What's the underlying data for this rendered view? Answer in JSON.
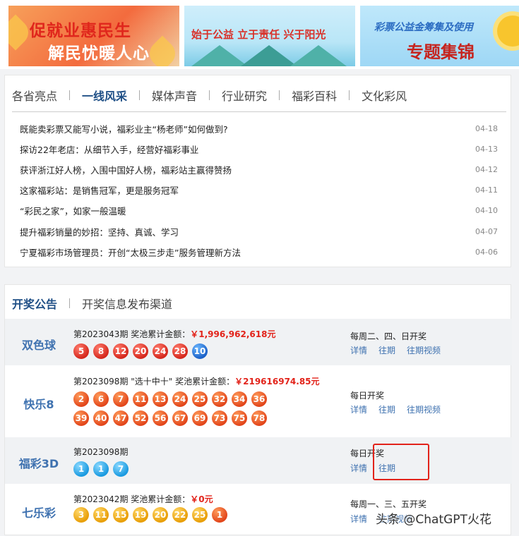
{
  "banners": [
    {
      "line1": "促就业惠民生",
      "line2": "解民忧暖人心"
    },
    {
      "line1": "始于公益 立于责任 兴于阳光"
    },
    {
      "line1": "彩票公益金筹集及使用",
      "line2": "专题集锦"
    }
  ],
  "news": {
    "tabs": [
      "各省亮点",
      "一线风采",
      "媒体声音",
      "行业研究",
      "福彩百科",
      "文化彩风"
    ],
    "active_tab": "一线风采",
    "items": [
      {
        "title": "既能卖彩票又能写小说，福彩业主“杨老师”如何做到?",
        "date": "04-18"
      },
      {
        "title": "探访22年老店：从细节入手，经营好福彩事业",
        "date": "04-13"
      },
      {
        "title": "获评浙江好人榜，入围中国好人榜，福彩站主赢得赞扬",
        "date": "04-12"
      },
      {
        "title": "这家福彩站：是销售冠军，更是服务冠军",
        "date": "04-11"
      },
      {
        "title": "“彩民之家”，如家一般温暖",
        "date": "04-10"
      },
      {
        "title": "提升福彩销量的妙招：坚持、真诚、学习",
        "date": "04-07"
      },
      {
        "title": "宁夏福彩市场管理员：开创“太极三步走”服务管理新方法",
        "date": "04-06"
      }
    ]
  },
  "draw": {
    "tabs": [
      "开奖公告",
      "开奖信息发布渠道"
    ],
    "games": [
      {
        "name": "双色球",
        "issue_text": "第2023043期  奖池累计金额：",
        "amount": "￥1,996,962,618元",
        "red": [
          "5",
          "8",
          "12",
          "20",
          "24",
          "28"
        ],
        "blue": [
          "10"
        ],
        "schedule": "每周二、四、日开奖",
        "links": [
          "详情",
          "往期",
          "往期视频"
        ]
      },
      {
        "name": "快乐8",
        "issue_text": "第2023098期  \"选十中十\" 奖池累计金额：",
        "amount": "￥219616974.85元",
        "numbers": [
          "2",
          "6",
          "7",
          "11",
          "13",
          "24",
          "25",
          "32",
          "34",
          "36",
          "39",
          "40",
          "47",
          "52",
          "56",
          "67",
          "69",
          "73",
          "75",
          "78"
        ],
        "schedule": "每日开奖",
        "links": [
          "详情",
          "往期",
          "往期视频"
        ]
      },
      {
        "name": "福彩3D",
        "issue_text": "第2023098期",
        "numbers": [
          "1",
          "1",
          "7"
        ],
        "schedule": "每日开奖",
        "links": [
          "详情",
          "往期"
        ]
      },
      {
        "name": "七乐彩",
        "issue_text": "第2023042期  奖池累计金额：",
        "amount": "￥0元",
        "basic": [
          "3",
          "11",
          "15",
          "19",
          "20",
          "22",
          "25"
        ],
        "special": [
          "1"
        ],
        "schedule": "每周一、三、五开奖",
        "links": [
          "详情",
          "往期视频"
        ]
      }
    ]
  },
  "watermark": "头条 @ChatGPT火花",
  "colors": {
    "accent": "#1f4f86",
    "prize": "#e2231a",
    "link": "#3f72b0",
    "highlight_box": "#e2231a"
  }
}
